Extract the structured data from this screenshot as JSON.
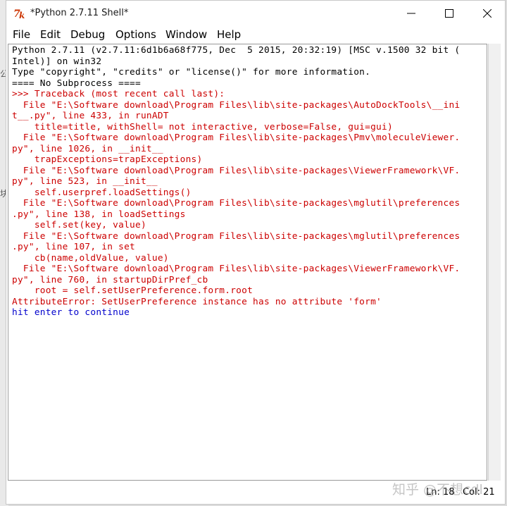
{
  "window": {
    "title": "*Python 2.7.11 Shell*"
  },
  "background": {
    "chars": [
      "公",
      "块"
    ]
  },
  "menu": [
    {
      "id": "file",
      "label": "File"
    },
    {
      "id": "edit",
      "label": "Edit"
    },
    {
      "id": "debug",
      "label": "Debug"
    },
    {
      "id": "options",
      "label": "Options"
    },
    {
      "id": "window",
      "label": "Window"
    },
    {
      "id": "help",
      "label": "Help"
    }
  ],
  "shell": {
    "lines": [
      {
        "text": "Python 2.7.11 (v2.7.11:6d1b6a68f775, Dec  5 2015, 20:32:19) [MSC v.1500 32 bit (",
        "color": "black"
      },
      {
        "text": "Intel)] on win32",
        "color": "black"
      },
      {
        "text": "Type \"copyright\", \"credits\" or \"license()\" for more information.",
        "color": "black"
      },
      {
        "text": "==== No Subprocess ====",
        "color": "black"
      },
      {
        "text": ">>> Traceback (most recent call last):",
        "color": "red"
      },
      {
        "text": "  File \"E:\\Software download\\Program Files\\lib\\site-packages\\AutoDockTools\\__ini",
        "color": "red"
      },
      {
        "text": "t__.py\", line 433, in runADT",
        "color": "red"
      },
      {
        "text": "    title=title, withShell= not interactive, verbose=False, gui=gui)",
        "color": "red"
      },
      {
        "text": "  File \"E:\\Software download\\Program Files\\lib\\site-packages\\Pmv\\moleculeViewer.",
        "color": "red"
      },
      {
        "text": "py\", line 1026, in __init__",
        "color": "red"
      },
      {
        "text": "    trapExceptions=trapExceptions)",
        "color": "red"
      },
      {
        "text": "  File \"E:\\Software download\\Program Files\\lib\\site-packages\\ViewerFramework\\VF.",
        "color": "red"
      },
      {
        "text": "py\", line 523, in __init__",
        "color": "red"
      },
      {
        "text": "    self.userpref.loadSettings()",
        "color": "red"
      },
      {
        "text": "  File \"E:\\Software download\\Program Files\\lib\\site-packages\\mglutil\\preferences",
        "color": "red"
      },
      {
        "text": ".py\", line 138, in loadSettings",
        "color": "red"
      },
      {
        "text": "    self.set(key, value)",
        "color": "red"
      },
      {
        "text": "  File \"E:\\Software download\\Program Files\\lib\\site-packages\\mglutil\\preferences",
        "color": "red"
      },
      {
        "text": ".py\", line 107, in set",
        "color": "red"
      },
      {
        "text": "    cb(name,oldValue, value)",
        "color": "red"
      },
      {
        "text": "  File \"E:\\Software download\\Program Files\\lib\\site-packages\\ViewerFramework\\VF.",
        "color": "red"
      },
      {
        "text": "py\", line 760, in startupDirPref_cb",
        "color": "red"
      },
      {
        "text": "    root = self.setUserPreference.form.root",
        "color": "red"
      },
      {
        "text": "AttributeError: SetUserPreference instance has no attribute 'form'",
        "color": "red"
      },
      {
        "text": "hit enter to continue",
        "color": "blue"
      }
    ]
  },
  "status": {
    "ln": "Ln: 18",
    "col": "Col: 21"
  },
  "watermark": "知乎 @不想cdl",
  "colors": {
    "output": "#000000",
    "error": "#cc0000",
    "stdout": "#0000cc",
    "logo": "#cc3300"
  }
}
